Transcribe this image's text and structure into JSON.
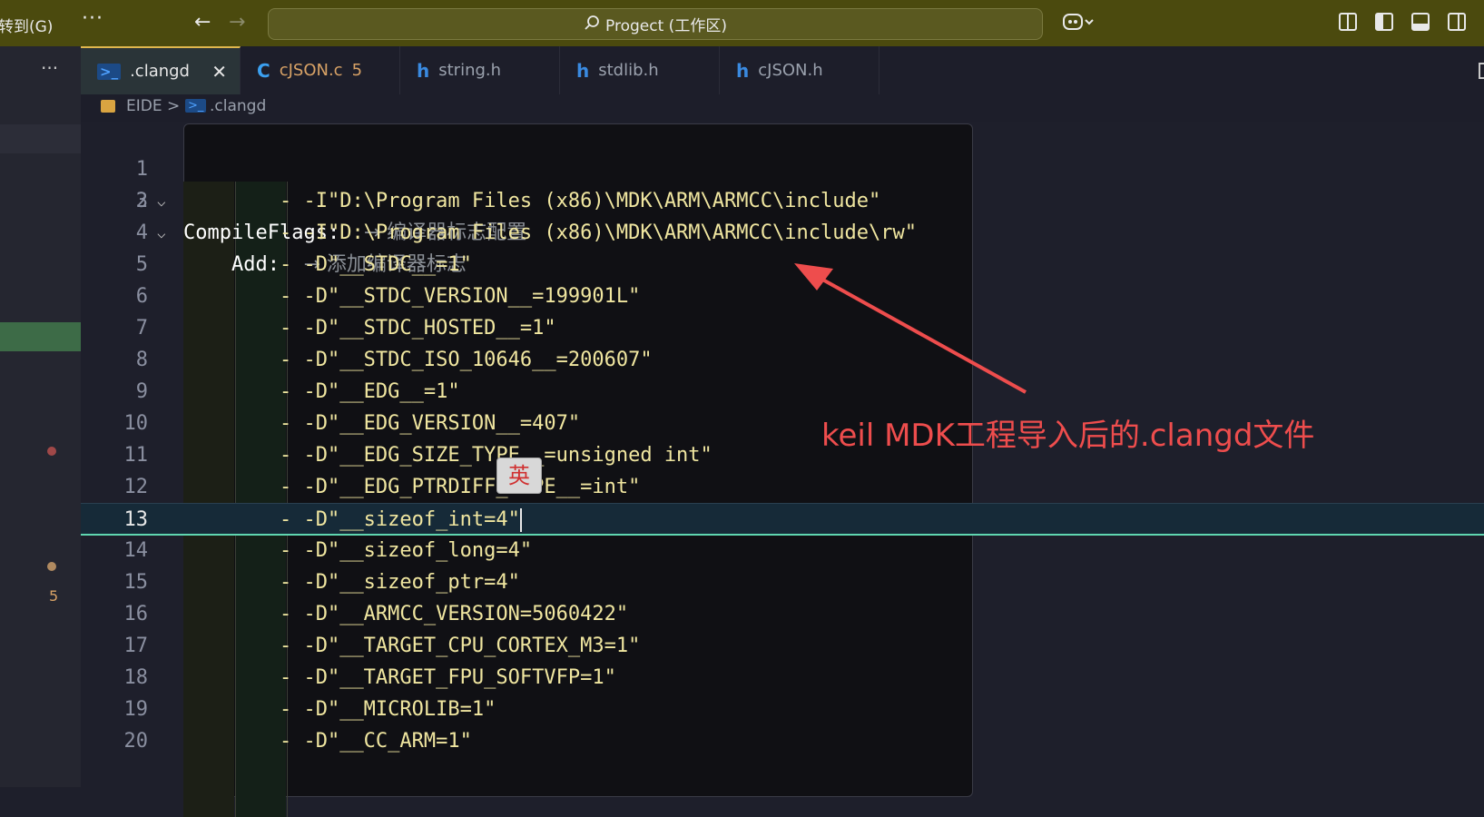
{
  "titlebar": {
    "menu_goto": "转到(G)",
    "menu_more": "···",
    "back": "←",
    "forward": "→",
    "search_label": "Progect (工作区)"
  },
  "sidebar": {
    "more": "···",
    "problem_count": "5"
  },
  "tabs": [
    {
      "label": ".clangd",
      "icon": "powershell-icon",
      "active": true,
      "close": "✕"
    },
    {
      "label": "cJSON.c",
      "icon": "c-file-icon",
      "badge": "5"
    },
    {
      "label": "string.h",
      "icon": "header-file-icon"
    },
    {
      "label": "stdlib.h",
      "icon": "header-file-icon"
    },
    {
      "label": "cJSON.h",
      "icon": "header-file-icon"
    }
  ],
  "breadcrumb": {
    "folder": "EIDE",
    "separator": ">",
    "file": ".clangd"
  },
  "editor": {
    "lines": [
      {
        "n": "1",
        "key": "CompileFlags:",
        "hint": "→ 编译器标志配置"
      },
      {
        "n": "2",
        "key": "Add:",
        "hint": "→ 添加编译器标志"
      },
      {
        "n": "3",
        "text": "- -I\"D:\\Program Files (x86)\\MDK\\ARM\\ARMCC\\include\""
      },
      {
        "n": "4",
        "text": "- -I\"D:\\Program Files (x86)\\MDK\\ARM\\ARMCC\\include\\rw\""
      },
      {
        "n": "5",
        "text": "- -D\"__STDC__=1\""
      },
      {
        "n": "6",
        "text": "- -D\"__STDC_VERSION__=199901L\""
      },
      {
        "n": "7",
        "text": "- -D\"__STDC_HOSTED__=1\""
      },
      {
        "n": "8",
        "text": "- -D\"__STDC_ISO_10646__=200607\""
      },
      {
        "n": "9",
        "text": "- -D\"__EDG__=1\""
      },
      {
        "n": "10",
        "text": "- -D\"__EDG_VERSION__=407\""
      },
      {
        "n": "11",
        "text": "- -D\"__EDG_SIZE_TYPE__=unsigned int\""
      },
      {
        "n": "12",
        "text": "- -D\"__EDG_PTRDIFF_TYPE__=int\""
      },
      {
        "n": "13",
        "text": "- -D\"__sizeof_int=4\""
      },
      {
        "n": "14",
        "text": "- -D\"__sizeof_long=4\""
      },
      {
        "n": "15",
        "text": "- -D\"__sizeof_ptr=4\""
      },
      {
        "n": "16",
        "text": "- -D\"__ARMCC_VERSION=5060422\""
      },
      {
        "n": "17",
        "text": "- -D\"__TARGET_CPU_CORTEX_M3=1\""
      },
      {
        "n": "18",
        "text": "- -D\"__TARGET_FPU_SOFTVFP=1\""
      },
      {
        "n": "19",
        "text": "- -D\"__MICROLIB=1\""
      },
      {
        "n": "20",
        "text": "- -D\"__CC_ARM=1\""
      }
    ],
    "ime_indicator": "英"
  },
  "annotation": {
    "text": "keil MDK工程导入后的.clangd文件",
    "color": "#ee4d4d"
  }
}
